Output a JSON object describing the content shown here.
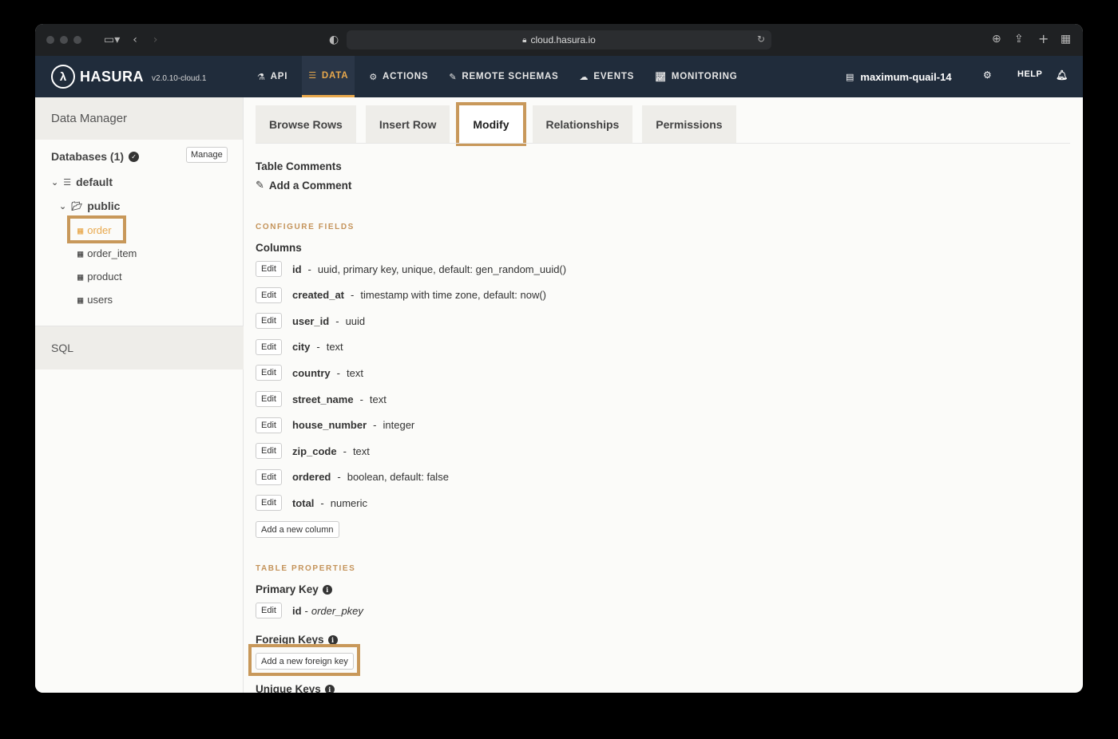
{
  "browser": {
    "url": "cloud.hasura.io"
  },
  "header": {
    "logo_text": "HASURA",
    "version": "v2.0.10-cloud.1",
    "nav": [
      {
        "label": "API",
        "icon": "flask-icon"
      },
      {
        "label": "DATA",
        "icon": "database-icon"
      },
      {
        "label": "ACTIONS",
        "icon": "cogs-icon"
      },
      {
        "label": "REMOTE SCHEMAS",
        "icon": "plug-icon"
      },
      {
        "label": "EVENTS",
        "icon": "cloud-icon"
      },
      {
        "label": "MONITORING",
        "icon": "chart-icon"
      }
    ],
    "active_nav": "DATA",
    "project_name": "maximum-quail-14",
    "help_label": "HELP",
    "accent_color": "#e8a84c"
  },
  "sidebar": {
    "title": "Data Manager",
    "databases_label": "Databases (1)",
    "manage_label": "Manage",
    "database": "default",
    "schema": "public",
    "tables": [
      "order",
      "order_item",
      "product",
      "users"
    ],
    "active_table": "order",
    "sql_label": "SQL"
  },
  "tabs": [
    "Browse Rows",
    "Insert Row",
    "Modify",
    "Relationships",
    "Permissions"
  ],
  "active_tab": "Modify",
  "main": {
    "table_comments_label": "Table Comments",
    "add_comment_label": "Add a Comment",
    "configure_fields_label": "CONFIGURE FIELDS",
    "columns_label": "Columns",
    "edit_label": "Edit",
    "columns": [
      {
        "name": "id",
        "type": "uuid, primary key, unique, default: gen_random_uuid()"
      },
      {
        "name": "created_at",
        "type": "timestamp with time zone, default: now()"
      },
      {
        "name": "user_id",
        "type": "uuid"
      },
      {
        "name": "city",
        "type": "text"
      },
      {
        "name": "country",
        "type": "text"
      },
      {
        "name": "street_name",
        "type": "text"
      },
      {
        "name": "house_number",
        "type": "integer"
      },
      {
        "name": "zip_code",
        "type": "text"
      },
      {
        "name": "ordered",
        "type": "boolean, default: false"
      },
      {
        "name": "total",
        "type": "numeric"
      }
    ],
    "add_column_label": "Add a new column",
    "table_properties_label": "TABLE PROPERTIES",
    "primary_key_label": "Primary Key",
    "primary_key": {
      "column": "id",
      "constraint": "order_pkey"
    },
    "foreign_keys_label": "Foreign Keys",
    "add_foreign_key_label": "Add a new foreign key",
    "unique_keys_label": "Unique Keys"
  }
}
